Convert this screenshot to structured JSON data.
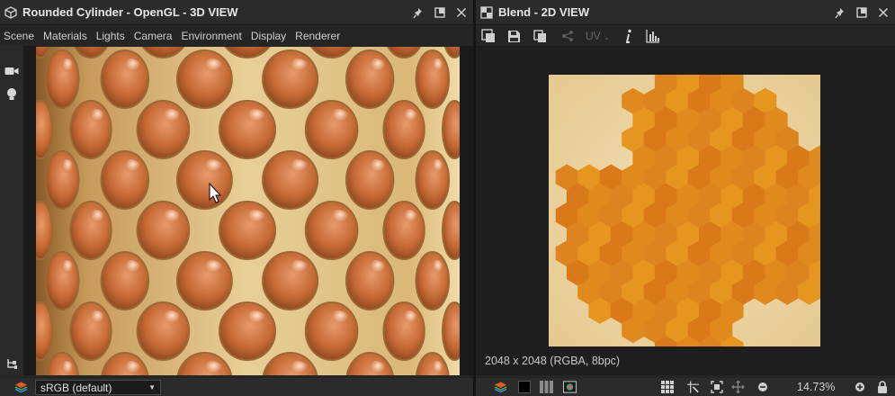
{
  "left_panel": {
    "title": "Rounded Cylinder - OpenGL - 3D VIEW",
    "menu": [
      "Scene",
      "Materials",
      "Lights",
      "Camera",
      "Environment",
      "Display",
      "Renderer"
    ],
    "colorspace": "sRGB (default)"
  },
  "right_panel": {
    "title": "Blend - 2D VIEW",
    "uv_label": "UV",
    "texture_info": "2048 x 2048 (RGBA, 8bpc)",
    "zoom": "14.73%"
  },
  "colors": {
    "panel_bg": "#252525",
    "titlebar_bg": "#2b2b2b",
    "honey_orange": "#e08a1e",
    "wax": "#e9d19b"
  }
}
